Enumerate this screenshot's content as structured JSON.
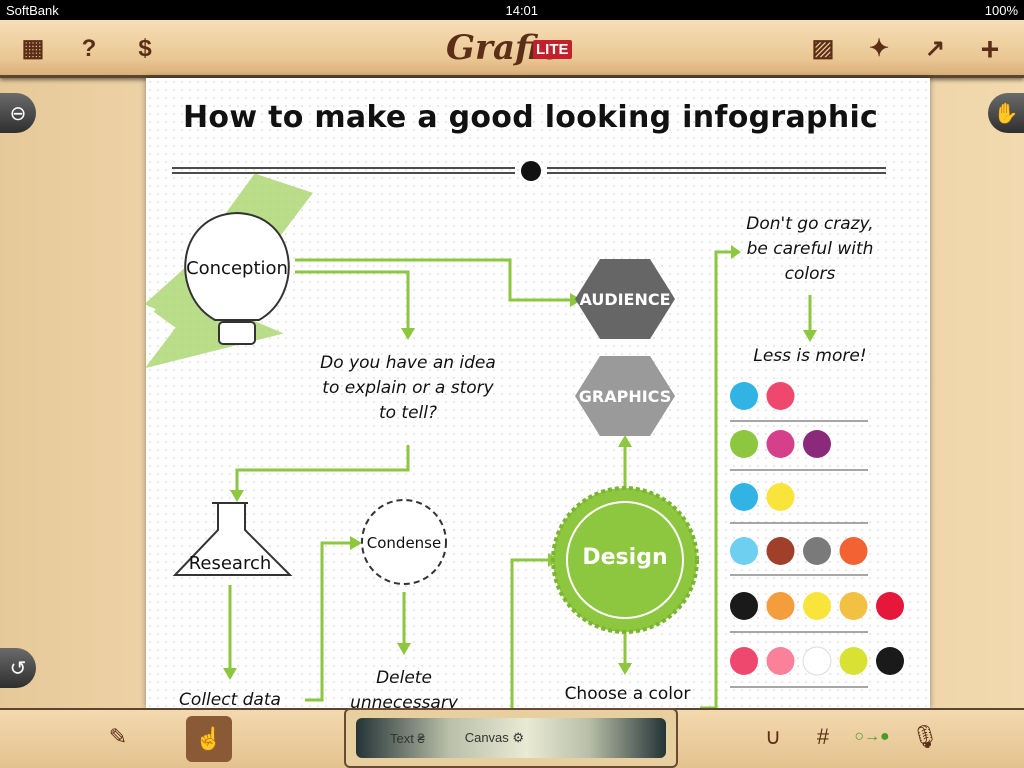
{
  "status": {
    "carrier": "SoftBank",
    "time": "14:01",
    "battery": "100%"
  },
  "toolbar": {
    "logo": "Grafio",
    "badge": "LITE",
    "left_icons": [
      "grid-icon",
      "help-icon",
      "price-tag-icon"
    ],
    "right_icons": [
      "image-icon",
      "shapes-icon",
      "share-icon",
      "plus-icon"
    ]
  },
  "page": {
    "title": "How to make a good looking infographic",
    "conception": "Conception",
    "question": [
      "Do you have an idea",
      "to explain or a story",
      "to tell?"
    ],
    "research": "Research",
    "collect": "Collect data",
    "condense": "Condense",
    "delete": [
      "Delete",
      "unnecessary"
    ],
    "audience": "AUDIENCE",
    "graphics": "GRAPHICS",
    "design": "Design",
    "choose": "Choose a color",
    "tip": [
      "Don't go crazy,",
      "be careful with",
      "colors"
    ],
    "less": "Less is more!",
    "palettes": [
      [
        "#31b4e3",
        "#ef486e"
      ],
      [
        "#8dc63f",
        "#d63f8a",
        "#8b2a7b"
      ],
      [
        "#31b4e3",
        "#f8e43b"
      ],
      [
        "#6fcff0",
        "#a0402b",
        "#7a7a7a",
        "#f26232"
      ],
      [
        "#1a1a1a",
        "#f49d3c",
        "#f8e43b",
        "#f2c043",
        "#e5173a"
      ],
      [
        "#ef486e",
        "#fb8099",
        "#ffffff",
        "#d9e132",
        "#1a1a1a"
      ]
    ],
    "green": "#8dc63f"
  },
  "bottom": {
    "text_mode": "Text",
    "canvas_mode": "Canvas"
  }
}
